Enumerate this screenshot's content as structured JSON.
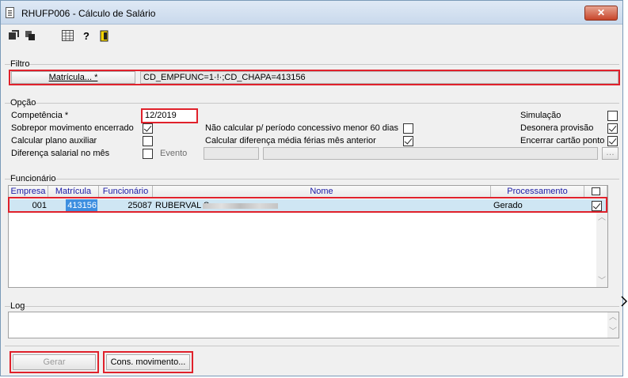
{
  "window": {
    "title": "RHUFP006 - Cálculo de Salário",
    "close_label": "✕"
  },
  "toolbar": {
    "icons": [
      "export-icon",
      "copy-icon",
      "grid-icon",
      "help-icon",
      "exit-icon"
    ]
  },
  "filtro": {
    "label": "Filtro",
    "matricula_button": "Matrícula... *",
    "value": "CD_EMPFUNC=1·!·;CD_CHAPA=413156"
  },
  "opcao": {
    "label": "Opção",
    "competencia_label": "Competência *",
    "competencia_value": "12/2019",
    "sobrepor_label": "Sobrepor movimento encerrado",
    "sobrepor_checked": true,
    "plano_label": "Calcular plano auxiliar",
    "plano_checked": false,
    "diferenca_label": "Diferença salarial no mês",
    "diferenca_checked": false,
    "evento_label": "Evento",
    "evento_value": "",
    "evento_desc": "",
    "nao_calcular_label": "Não calcular p/ período concessivo menor 60 dias",
    "nao_calcular_checked": false,
    "diferenca_media_label": "Calcular diferença média férias mês anterior",
    "diferenca_media_checked": true,
    "simulacao_label": "Simulação",
    "simulacao_checked": false,
    "desonera_label": "Desonera provisão",
    "desonera_checked": true,
    "encerrar_label": "Encerrar cartão ponto",
    "encerrar_checked": true
  },
  "funcionario": {
    "label": "Funcionário",
    "columns": [
      "Empresa",
      "Matrícula",
      "Funcionário",
      "Nome",
      "Processamento",
      ""
    ],
    "rows": [
      {
        "empresa": "001",
        "matricula": "413156",
        "funcionario": "25087",
        "nome": "RUBERVAL S",
        "processamento": "Gerado",
        "selected": true
      }
    ]
  },
  "log": {
    "label": "Log",
    "text": ""
  },
  "actions": {
    "gerar": "Gerar",
    "cons_movimento": "Cons. movimento..."
  }
}
